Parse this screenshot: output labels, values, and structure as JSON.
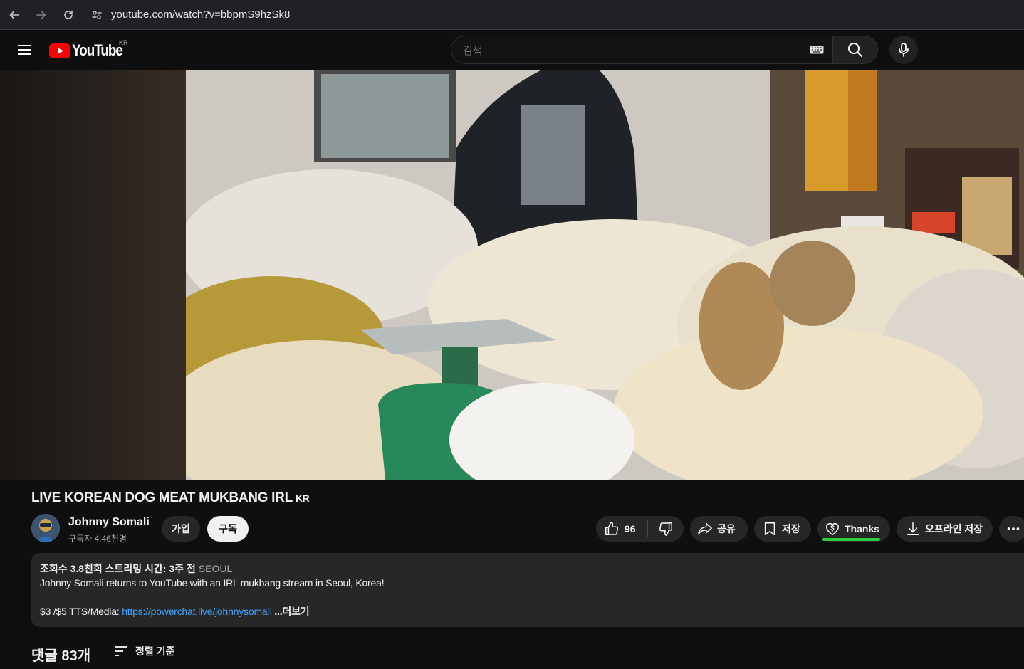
{
  "browser": {
    "url": "youtube.com/watch?v=bbpmS9hzSk8"
  },
  "header": {
    "logo_text": "YouTube",
    "logo_country": "KR",
    "search_placeholder": "검색"
  },
  "video": {
    "title": "LIVE KOREAN DOG MEAT MUKBANG IRL",
    "title_badge": "KR"
  },
  "channel": {
    "name": "Johnny Somali",
    "subscribers": "구독자 4.46천명",
    "join_label": "가입",
    "subscribe_label": "구독"
  },
  "actions": {
    "like_count": "96",
    "share_label": "공유",
    "save_label": "저장",
    "thanks_label": "Thanks",
    "download_label": "오프라인 저장"
  },
  "description": {
    "meta": "조회수 3.8천회  스트리밍 시간: 3주 전",
    "location": "SEOUL",
    "line1": "Johnny Somali returns to YouTube with an IRL mukbang stream in Seoul, Korea!",
    "line2_prefix": "$3 /$5 TTS/Media: ",
    "line2_link": "https://powerchat.live/johnnysoma",
    "line2_fade": "li",
    "more_label": "...더보기"
  },
  "comments": {
    "count_label": "댓글 83개",
    "sort_label": "정렬 기준"
  },
  "colors": {
    "brand_red": "#ff0000",
    "thanks_green": "#2ecc40",
    "link_blue": "#3ea6ff"
  }
}
